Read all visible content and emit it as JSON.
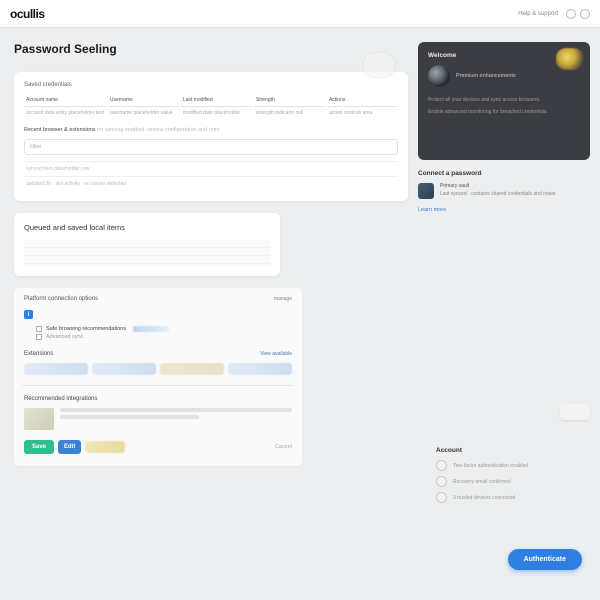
{
  "brand": "ocullis",
  "top_link": "Help & support",
  "page_title": "Password Seeling",
  "section1_label": "Saved credentials",
  "table_cols": [
    {
      "head": "Account name",
      "cell": "account data entry placeholder text"
    },
    {
      "head": "Username",
      "cell": "username placeholder value"
    },
    {
      "head": "Last modified",
      "cell": "modified date placeholder"
    },
    {
      "head": "Strength",
      "cell": "strength indicator cell"
    },
    {
      "head": "Actions",
      "cell": "action controls area"
    }
  ],
  "hint_strong": "Recent browser & extensions",
  "hint_faded": "no syncing enabled, review configuration and retry",
  "filter_placeholder": "Filter",
  "thin_row1": "synced item placeholder row",
  "thin_row2": "updated 2h · last activity · no issues detected",
  "card2_title": "Queued and saved local items",
  "panel3": {
    "title": "Platform connection options",
    "action": "manage",
    "info_chip": "i",
    "check1": "Safe browsing recommendations",
    "check2": "Advanced sync",
    "sec_title": "Extensions",
    "sec_link": "View available",
    "rec_title": "Recommended integrations"
  },
  "buttons": {
    "save": "Save",
    "secondary": "Edit",
    "ghost": "Cancel"
  },
  "promo": {
    "title": "Welcome",
    "sub": "Premium enhancements",
    "desc1": "Protect all your devices and sync across browsers.",
    "desc2": "Enable advanced monitoring for breached credentials."
  },
  "side_cred": {
    "title": "Connect a password",
    "line_title": "Primary vault",
    "line_desc": "Last synced · contains shared credentials and notes",
    "link": "Learn more"
  },
  "account": {
    "title": "Account",
    "items": [
      "Two-factor authentication enabled",
      "Recovery email confirmed",
      "3 trusted devices connected"
    ]
  },
  "cta": "Authenticate"
}
